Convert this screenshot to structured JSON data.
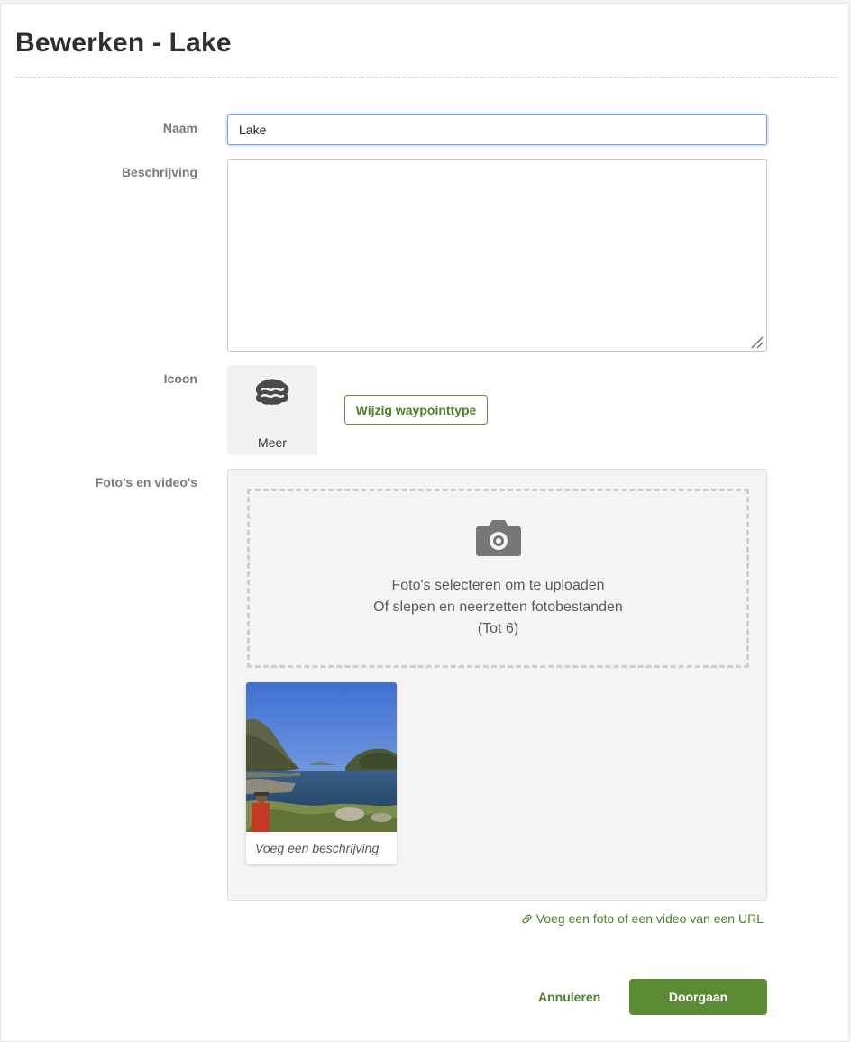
{
  "page": {
    "title": "Bewerken - Lake"
  },
  "form": {
    "name_label": "Naam",
    "name_value": "Lake",
    "description_label": "Beschrijving",
    "description_value": "",
    "icon_label": "Icoon",
    "icon_name": "lake-icon",
    "icon_caption": "Meer",
    "change_type_button": "Wijzig waypointtype",
    "media_label": "Foto's en video's"
  },
  "upload": {
    "icon_name": "camera-icon",
    "line1": "Foto's selecteren om te uploaden",
    "line2": "Of slepen en neerzetten fotobestanden",
    "line3": "(Tot 6)"
  },
  "photos": [
    {
      "caption_placeholder": "Voeg een beschrijving"
    }
  ],
  "actions": {
    "add_url_icon": "link-icon",
    "add_url_link": "Voeg een foto of een video van een URL",
    "cancel_label": "Annuleren",
    "submit_label": "Doorgaan"
  },
  "colors": {
    "accent_green": "#5b8b35",
    "link_green": "#4f7f2a",
    "focus_blue": "#6ea6e8"
  }
}
